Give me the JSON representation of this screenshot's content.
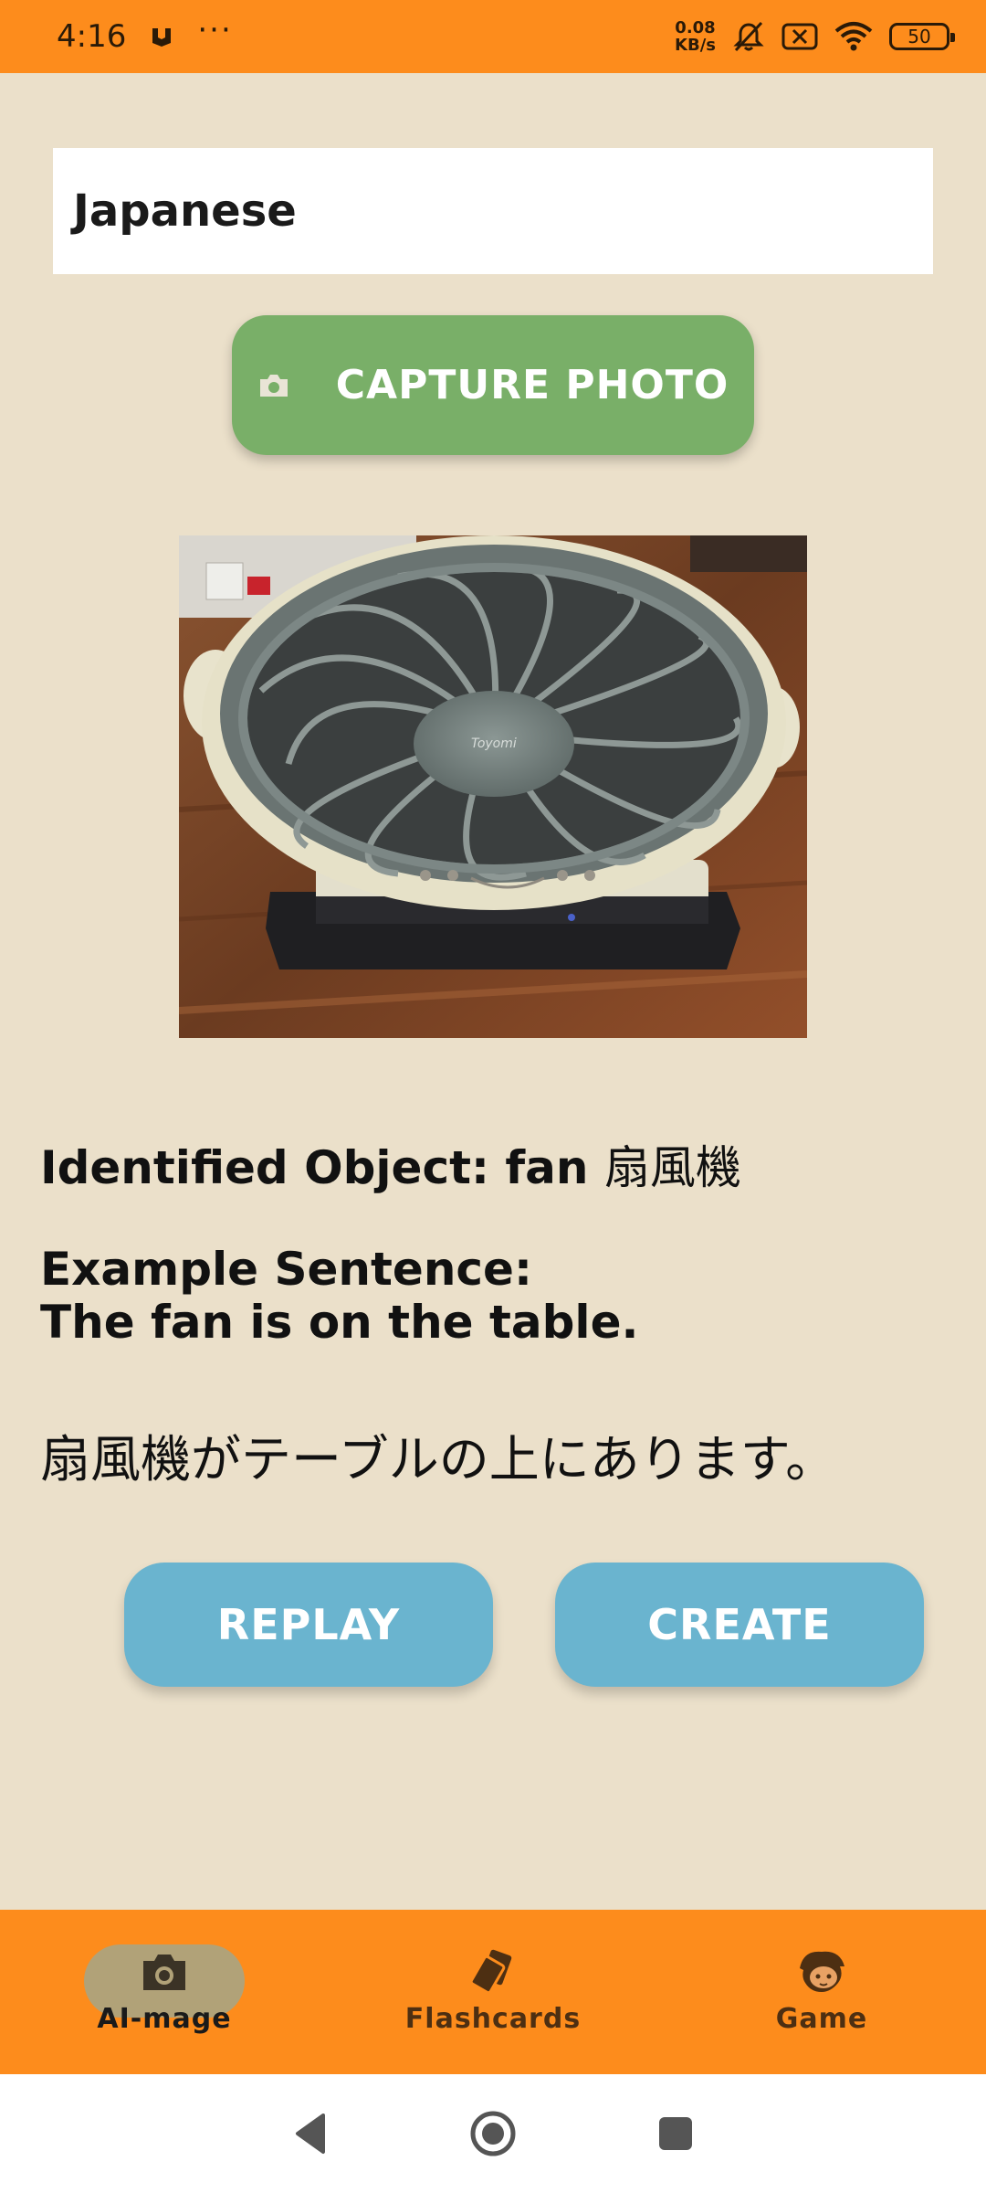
{
  "status_bar": {
    "time": "4:16",
    "dots": "···",
    "speed_value": "0.08",
    "speed_unit": "KB/s",
    "battery": "50"
  },
  "language_field": {
    "value": "Japanese"
  },
  "capture_button": {
    "label": "CAPTURE PHOTO"
  },
  "result": {
    "identified_label": "Identified Object: fan ",
    "identified_jp": "扇風機",
    "example_label": "Example Sentence:",
    "example_en": "The fan is on the table.",
    "example_jp": "扇風機がテーブルの上にあります。"
  },
  "actions": {
    "replay_label": "REPLAY",
    "create_label": "CREATE"
  },
  "bottom_nav": {
    "items": [
      {
        "label": "AI-mage",
        "icon": "camera-icon",
        "active": true
      },
      {
        "label": "Flashcards",
        "icon": "cards-icon",
        "active": false
      },
      {
        "label": "Game",
        "icon": "game-character-icon",
        "active": false
      }
    ]
  },
  "colors": {
    "accent": "#FD8C1C",
    "background": "#EBE0CA",
    "capture_button": "#79AF68",
    "action_button": "#6AB4CF"
  }
}
